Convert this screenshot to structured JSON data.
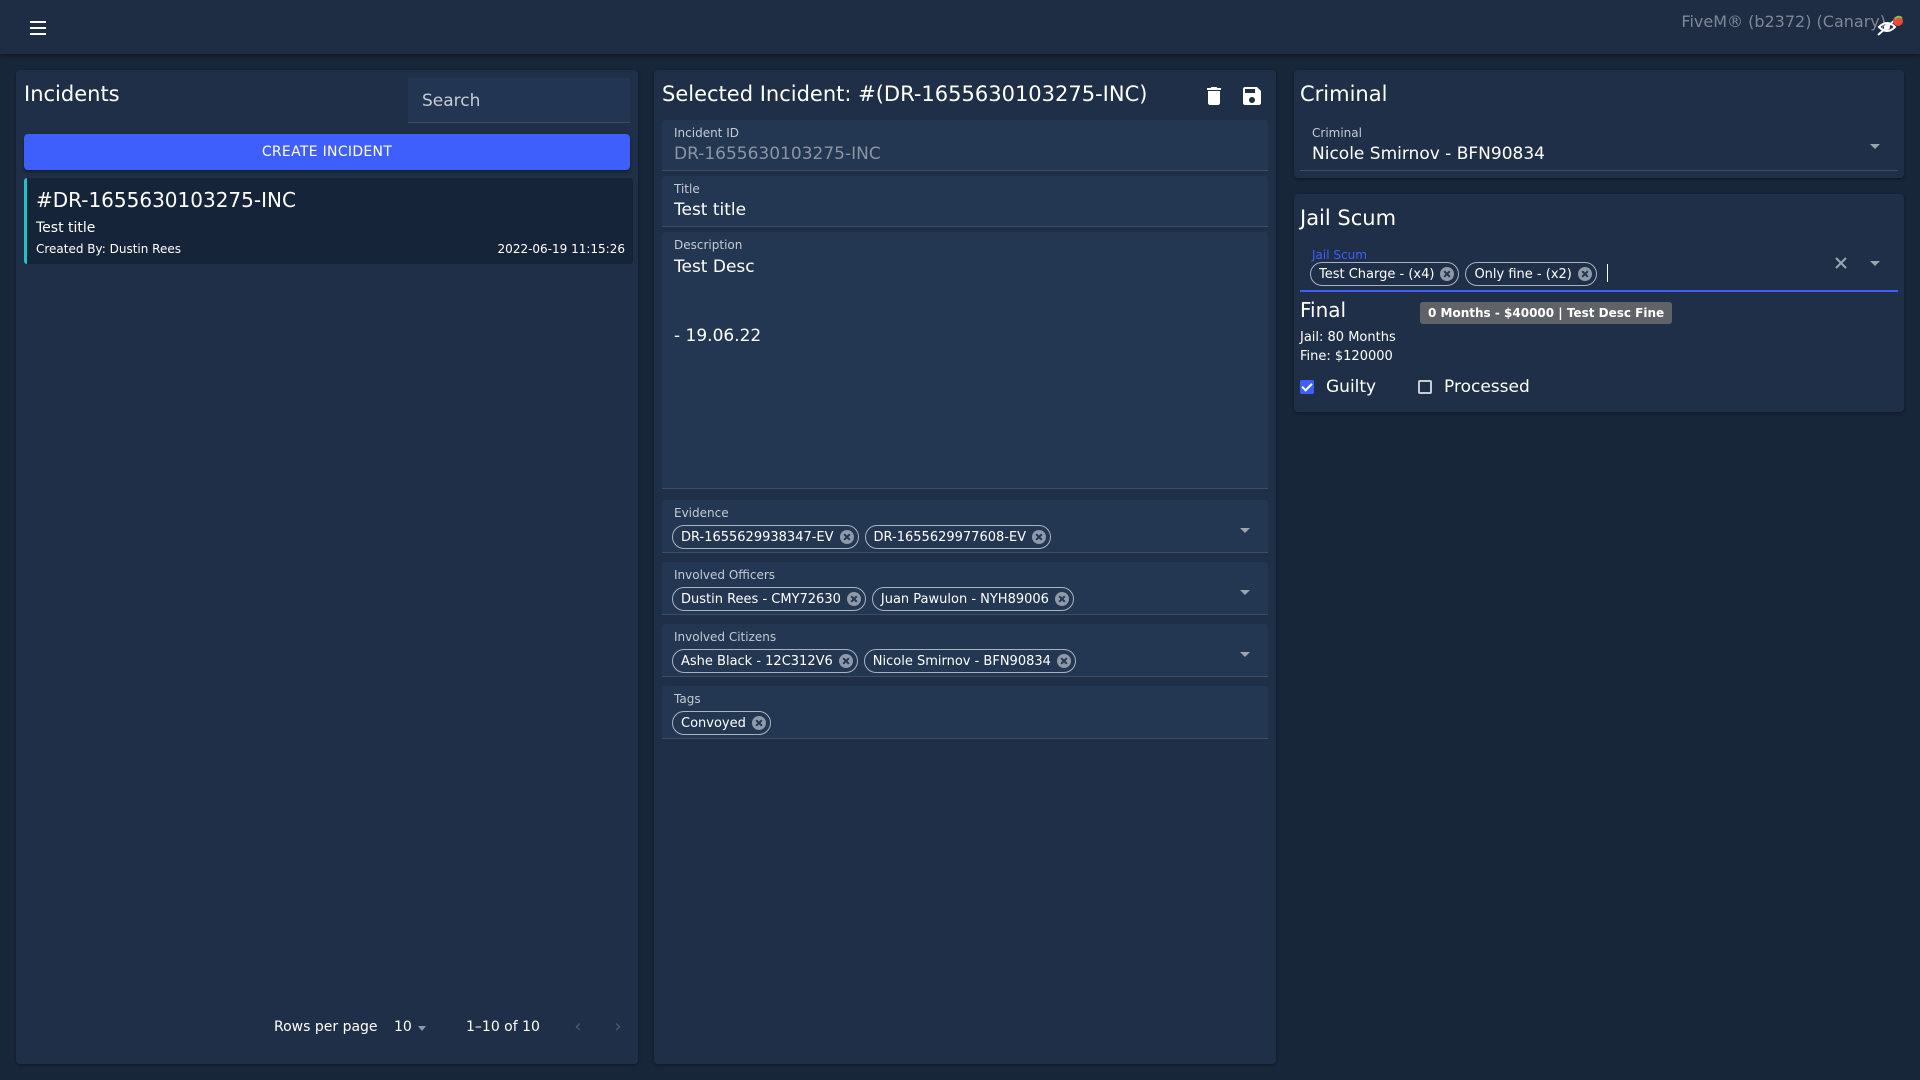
{
  "topbar": {
    "build_text": "FiveM® (b2372) (Canary)"
  },
  "icons": {
    "menu": "hamburger-menu-icon",
    "overlay": "eye-off-icon",
    "delete": "trash-icon",
    "save": "floppy-disk-icon"
  },
  "incidents": {
    "title": "Incidents",
    "search_placeholder": "Search",
    "create_label": "CREATE INCIDENT",
    "items": [
      {
        "id": "#DR-1655630103275-INC",
        "title": "Test title",
        "created_by": "Created By: Dustin Rees",
        "date": "2022-06-19 11:15:26"
      }
    ],
    "pagination": {
      "rows_per_page_label": "Rows per page",
      "rows_per_page_value": "10",
      "range": "1–10 of 10"
    }
  },
  "detail": {
    "title": "Selected Incident: #(DR-1655630103275-INC)",
    "incident_id": {
      "label": "Incident ID",
      "value": "DR-1655630103275-INC"
    },
    "title_field": {
      "label": "Title",
      "value": "Test title"
    },
    "description": {
      "label": "Description",
      "value": "Test Desc\n\n\n- 19.06.22"
    },
    "evidence": {
      "label": "Evidence",
      "chips": [
        "DR-1655629938347-EV",
        "DR-1655629977608-EV"
      ]
    },
    "officers": {
      "label": "Involved Officers",
      "chips": [
        "Dustin Rees - CMY72630",
        "Juan Pawulon - NYH89006"
      ]
    },
    "citizens": {
      "label": "Involved Citizens",
      "chips": [
        "Ashe Black - 12C312V6",
        "Nicole Smirnov - BFN90834"
      ]
    },
    "tags": {
      "label": "Tags",
      "chips": [
        "Convoyed"
      ]
    }
  },
  "criminal": {
    "title": "Criminal",
    "field_label": "Criminal",
    "field_value": "Nicole Smirnov - BFN90834"
  },
  "jail": {
    "title": "Jail Scum",
    "field_label": "Jail Scum",
    "chips": [
      "Test Charge - (x4)",
      "Only fine - (x2)"
    ],
    "final_title": "Final",
    "final_badge": "0 Months - $40000 | Test Desc Fine",
    "jail_line": "Jail: 80 Months",
    "fine_line": "Fine: $120000",
    "guilty_label": "Guilty",
    "guilty_checked": true,
    "processed_label": "Processed",
    "processed_checked": false
  },
  "colors": {
    "background": "#18263a",
    "panel": "#1f2f47",
    "accent": "#3e5ffb",
    "card_border": "#22c3c8"
  }
}
